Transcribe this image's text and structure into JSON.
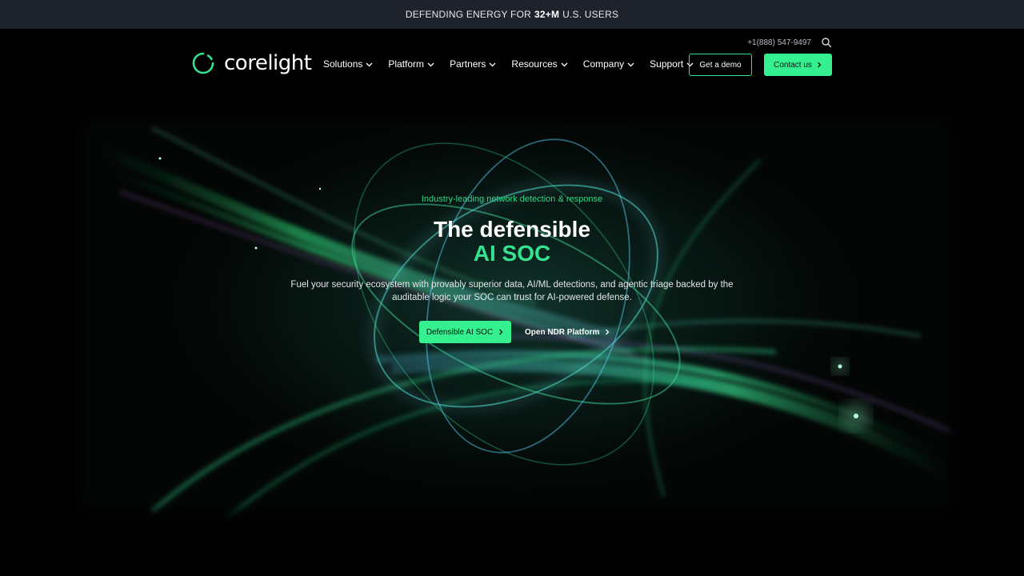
{
  "announcement": {
    "prefix": "DEFENDING ENERGY FOR",
    "highlight": "32+M",
    "suffix": "U.S. USERS"
  },
  "header": {
    "phone": "+1(888) 547-9497",
    "logo_text": "corelight",
    "nav": [
      {
        "label": "Solutions"
      },
      {
        "label": "Platform"
      },
      {
        "label": "Partners"
      },
      {
        "label": "Resources"
      },
      {
        "label": "Company"
      },
      {
        "label": "Support"
      }
    ],
    "demo_label": "Get a demo",
    "contact_label": "Contact us"
  },
  "hero": {
    "eyebrow": "Industry-leading network detection & response",
    "title_line1": "The defensible",
    "title_line2": "AI SOC",
    "lead": "Fuel your security ecosystem with provably superior data, AI/ML detections, and agentic triage backed by the auditable logic your SOC can trust for AI-powered defense.",
    "primary_cta": "Defensible AI SOC",
    "secondary_cta": "Open NDR Platform"
  },
  "colors": {
    "accent": "#34f08f",
    "accent_text": "#2fd886",
    "bar_bg": "#1e232b"
  },
  "icons": {
    "search": "search-icon",
    "chevron": "chevron-down-icon",
    "arrow": "arrow-right-icon",
    "logo": "corelight-logo-mark"
  }
}
